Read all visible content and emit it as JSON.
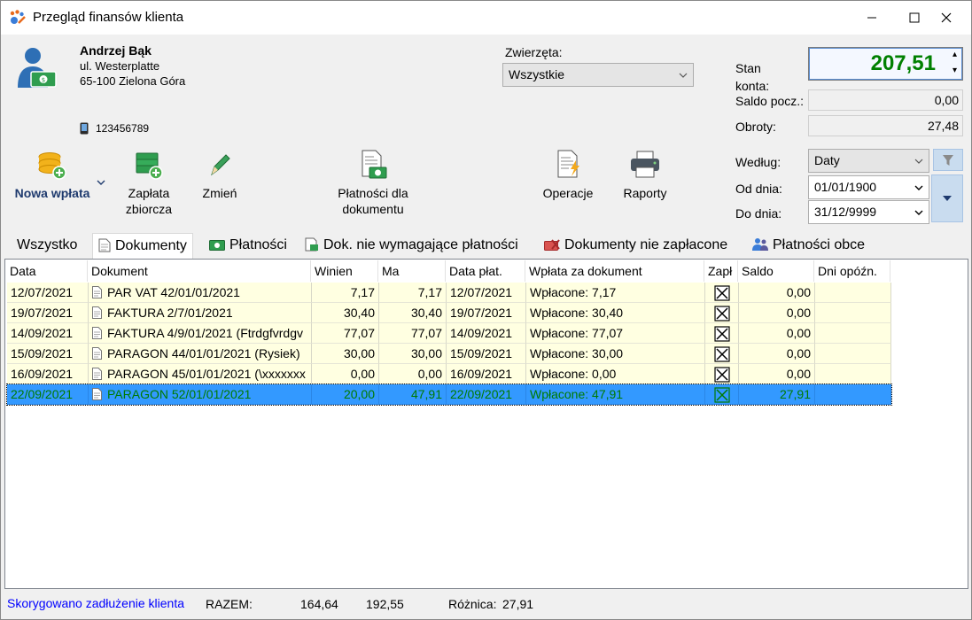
{
  "window": {
    "title": "Przegląd finansów klienta",
    "minimize_symbol": "—",
    "maximize_symbol": "☐",
    "close_symbol": "✕"
  },
  "client": {
    "name": "Andrzej Bąk",
    "street": "ul. Westerplatte",
    "city": "65-100 Zielona Góra",
    "phone": "123456789"
  },
  "animals": {
    "label": "Zwierzęta:",
    "selected": "Wszystkie"
  },
  "account": {
    "balance_label": "Stan konta:",
    "balance": "207,51",
    "opening_label": "Saldo pocz.:",
    "opening": "0,00",
    "turnover_label": "Obroty:",
    "turnover": "27,48"
  },
  "toolbar": {
    "new_payment": "Nowa wpłata",
    "bulk_payment": "Zapłata zbiorcza",
    "edit": "Zmień",
    "doc_payments": "Płatności dla dokumentu",
    "operations": "Operacje",
    "reports": "Raporty"
  },
  "filter": {
    "by_label": "Według:",
    "by_value": "Daty",
    "from_label": "Od dnia:",
    "from_value": "01/01/1900",
    "to_label": "Do dnia:",
    "to_value": "31/12/9999"
  },
  "tabs": [
    {
      "label": "Wszystko",
      "icon": "none"
    },
    {
      "label": "Dokumenty",
      "icon": "document-icon"
    },
    {
      "label": "Płatności",
      "icon": "banknote-icon"
    },
    {
      "label": "Dok. nie wymagające płatności",
      "icon": "receipt-icon"
    },
    {
      "label": "Dokumenty nie zapłacone",
      "icon": "unpaid-icon"
    },
    {
      "label": "Płatności obce",
      "icon": "people-icon"
    }
  ],
  "grid": {
    "columns": [
      "Data",
      "Dokument",
      "Winien",
      "Ma",
      "Data płat.",
      "Wpłata za dokument",
      "Zapł",
      "Saldo",
      "Dni opóźn."
    ],
    "rows": [
      {
        "date": "12/07/2021",
        "doc": "PAR VAT 42/01/01/2021",
        "owed": "7,17",
        "paid": "7,17",
        "pay_date": "12/07/2021",
        "payment": "Wpłacone: 7,17",
        "settled": true,
        "balance": "0,00",
        "delay": ""
      },
      {
        "date": "19/07/2021",
        "doc": "FAKTURA 2/7/01/2021",
        "owed": "30,40",
        "paid": "30,40",
        "pay_date": "19/07/2021",
        "payment": "Wpłacone: 30,40",
        "settled": true,
        "balance": "0,00",
        "delay": ""
      },
      {
        "date": "14/09/2021",
        "doc": "FAKTURA 4/9/01/2021 (Ftrdgfvrdgv",
        "owed": "77,07",
        "paid": "77,07",
        "pay_date": "14/09/2021",
        "payment": "Wpłacone: 77,07",
        "settled": true,
        "balance": "0,00",
        "delay": ""
      },
      {
        "date": "15/09/2021",
        "doc": "PARAGON 44/01/01/2021 (Rysiek)",
        "owed": "30,00",
        "paid": "30,00",
        "pay_date": "15/09/2021",
        "payment": "Wpłacone: 30,00",
        "settled": true,
        "balance": "0,00",
        "delay": ""
      },
      {
        "date": "16/09/2021",
        "doc": "PARAGON 45/01/01/2021 (\\xxxxxxx",
        "owed": "0,00",
        "paid": "0,00",
        "pay_date": "16/09/2021",
        "payment": "Wpłacone: 0,00",
        "settled": true,
        "balance": "0,00",
        "delay": ""
      },
      {
        "date": "22/09/2021",
        "doc": "PARAGON 52/01/01/2021",
        "owed": "20,00",
        "paid": "47,91",
        "pay_date": "22/09/2021",
        "payment": "Wpłacone: 47,91",
        "settled": true,
        "balance": "27,91",
        "delay": "",
        "selected": true
      }
    ]
  },
  "status": {
    "link": "Skorygowano zadłużenie klienta",
    "total_label": "RAZEM:",
    "total_owed": "164,64",
    "total_paid": "192,55",
    "diff_label": "Różnica:",
    "diff_value": "27,91"
  },
  "colors": {
    "balance_text": "#008000",
    "grid_row_bg": "#ffffe1",
    "selection_bg": "#3399ff",
    "selection_text": "#007a00",
    "link": "#0000ff"
  }
}
